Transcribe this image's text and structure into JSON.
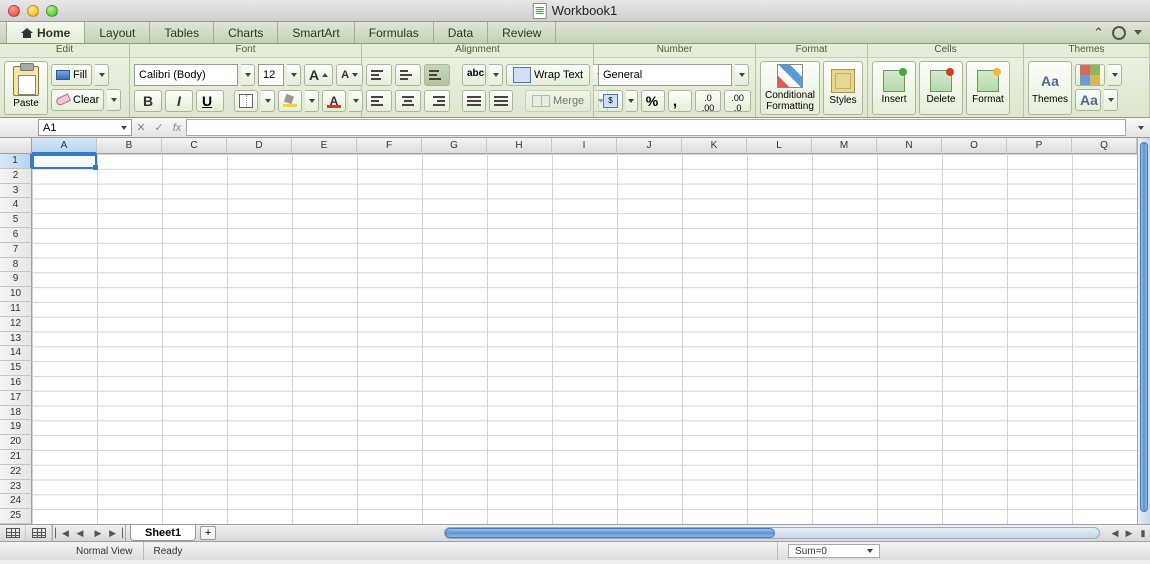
{
  "title": "Workbook1",
  "tabs": [
    "Home",
    "Layout",
    "Tables",
    "Charts",
    "SmartArt",
    "Formulas",
    "Data",
    "Review"
  ],
  "groups": {
    "edit": {
      "label": "Edit",
      "paste": "Paste",
      "fill": "Fill",
      "clear": "Clear"
    },
    "font": {
      "label": "Font",
      "name": "Calibri (Body)",
      "size": "12"
    },
    "alignment": {
      "label": "Alignment",
      "wrap": "Wrap Text",
      "merge": "Merge",
      "orient": "abc"
    },
    "number": {
      "label": "Number",
      "format": "General"
    },
    "format": {
      "label": "Format",
      "cond": "Conditional\nFormatting",
      "styles": "Styles"
    },
    "cells": {
      "label": "Cells",
      "insert": "Insert",
      "delete": "Delete",
      "format": "Format"
    },
    "themes": {
      "label": "Themes",
      "themes": "Themes",
      "aa": "Aa"
    }
  },
  "namebox": "A1",
  "columns": [
    "A",
    "B",
    "C",
    "D",
    "E",
    "F",
    "G",
    "H",
    "I",
    "J",
    "K",
    "L",
    "M",
    "N",
    "O",
    "P",
    "Q"
  ],
  "rows": 25,
  "sheet": "Sheet1",
  "status": {
    "view": "Normal View",
    "ready": "Ready",
    "sum": "Sum=0"
  }
}
